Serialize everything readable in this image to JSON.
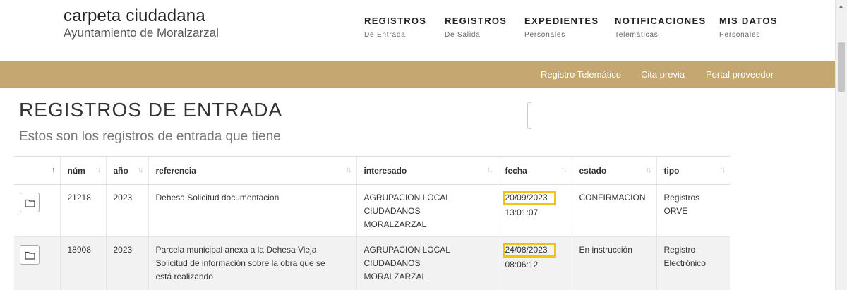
{
  "brand": {
    "title": "carpeta ciudadana",
    "subtitle": "Ayuntamiento de Moralzarzal"
  },
  "nav": [
    {
      "label": "REGISTROS",
      "sub": "De Entrada"
    },
    {
      "label": "REGISTROS",
      "sub": "De Salida"
    },
    {
      "label": "EXPEDIENTES",
      "sub": "Personales"
    },
    {
      "label": "NOTIFICACIONES",
      "sub": "Telemáticas"
    },
    {
      "label": "MIS DATOS",
      "sub": "Personales"
    }
  ],
  "links": [
    "Registro Telemático",
    "Cita previa",
    "Portal proveedor"
  ],
  "page": {
    "title": "REGISTROS DE ENTRADA",
    "subtitle": "Estos son los registros de entrada que tiene"
  },
  "table": {
    "headers": [
      "",
      "núm",
      "año",
      "referencia",
      "interesado",
      "fecha",
      "estado",
      "tipo"
    ],
    "sort_icon": "↑↓",
    "sort_active_icon": "↑",
    "rows": [
      {
        "num": "21218",
        "year": "2023",
        "referencia": [
          "Dehesa Solicitud documentacion"
        ],
        "interesado": [
          "AGRUPACION LOCAL",
          "CIUDADANOS",
          "MORALZARZAL"
        ],
        "fecha": "20/09/2023",
        "hora": "13:01:07",
        "estado": "CONFIRMACION",
        "tipo": [
          "Registros",
          "ORVE"
        ]
      },
      {
        "num": "18908",
        "year": "2023",
        "referencia": [
          "Parcela municipal anexa a la Dehesa Vieja",
          "Solicitud de información sobre la obra que se",
          "está realizando"
        ],
        "interesado": [
          "AGRUPACION LOCAL",
          "CIUDADANOS",
          "MORALZARZAL"
        ],
        "fecha": "24/08/2023",
        "hora": "08:06:12",
        "estado": "En instrucción",
        "tipo": [
          "Registro",
          "Electrónico"
        ]
      }
    ]
  },
  "colors": {
    "gold": "#c5a771",
    "highlight": "#f2c21b"
  },
  "icons": {
    "folder": "folder-icon",
    "scroll_up": "▲"
  }
}
